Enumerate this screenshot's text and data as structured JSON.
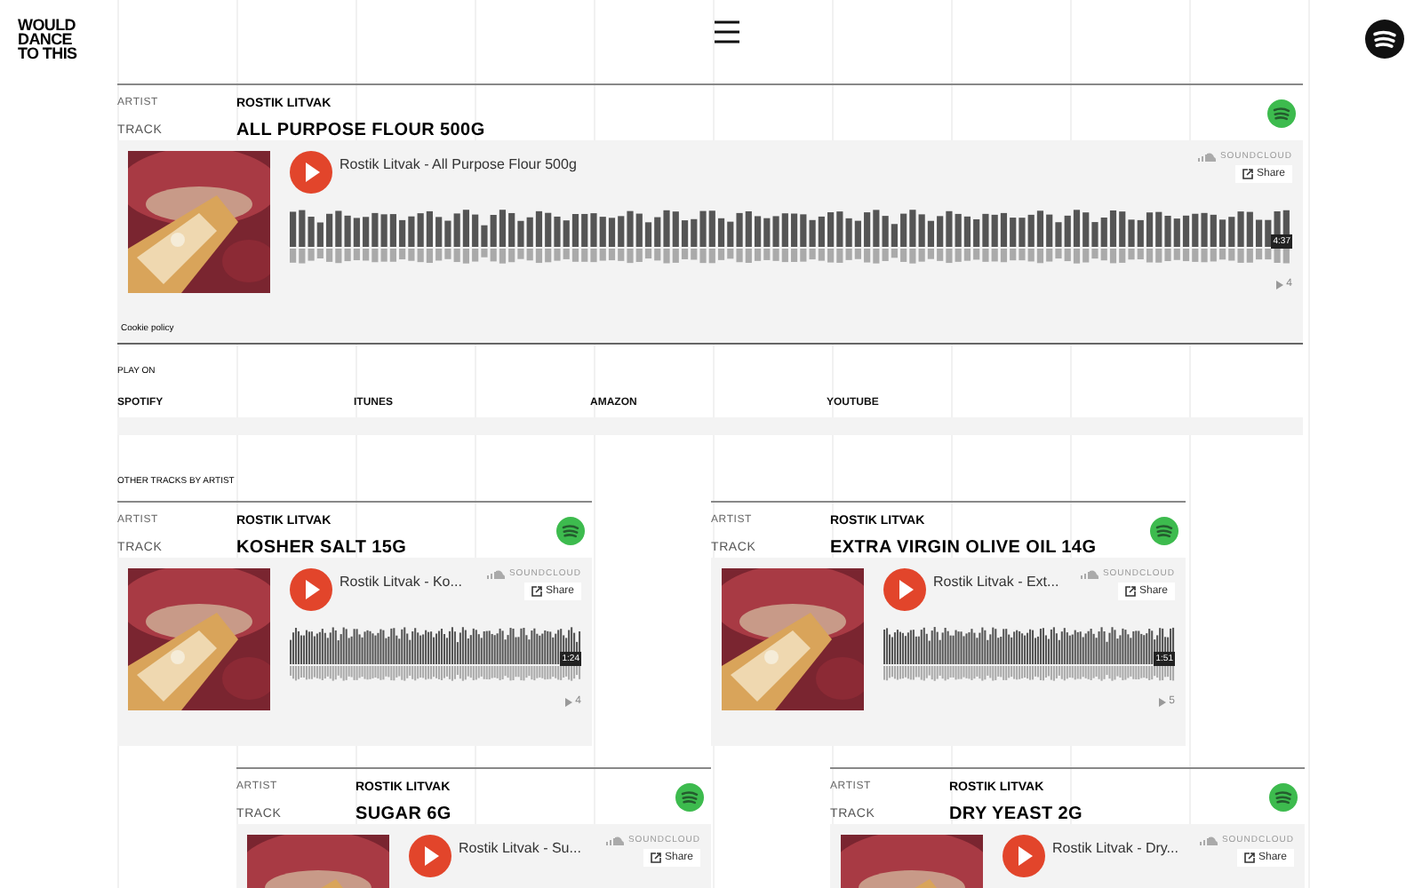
{
  "logo": "WOULD DANCE TO THIS",
  "featured": {
    "artist_label": "ARTIST",
    "artist": "ROSTIK LITVAK",
    "track_label": "TRACK",
    "track": "ALL PURPOSE FLOUR 500G",
    "player": {
      "title": "Rostik Litvak - All Purpose Flour 500g",
      "brand": "SOUNDCLOUD",
      "share": "Share",
      "duration": "4:37",
      "plays": "4"
    },
    "cookie": "Cookie policy"
  },
  "play_on": {
    "label": "PLAY ON",
    "links": [
      "SPOTIFY",
      "ITUNES",
      "AMAZON",
      "YOUTUBE"
    ]
  },
  "other_tracks": {
    "label": "OTHER TRACKS BY ARTIST",
    "tracks": [
      {
        "artist_label": "ARTIST",
        "artist": "ROSTIK LITVAK",
        "track_label": "TRACK",
        "track": "KOSHER SALT 15G",
        "player": {
          "title": "Rostik Litvak - Ko...",
          "brand": "SOUNDCLOUD",
          "share": "Share",
          "duration": "1:24",
          "plays": "4"
        }
      },
      {
        "artist_label": "ARTIST",
        "artist": "ROSTIK LITVAK",
        "track_label": "TRACK",
        "track": "EXTRA VIRGIN OLIVE OIL 14G",
        "player": {
          "title": "Rostik Litvak - Ext...",
          "brand": "SOUNDCLOUD",
          "share": "Share",
          "duration": "1:51",
          "plays": "5"
        }
      },
      {
        "artist_label": "ARTIST",
        "artist": "ROSTIK LITVAK",
        "track_label": "TRACK",
        "track": "SUGAR 6G",
        "player": {
          "title": "Rostik Litvak - Su...",
          "brand": "SOUNDCLOUD",
          "share": "Share"
        }
      },
      {
        "artist_label": "ARTIST",
        "artist": "ROSTIK LITVAK",
        "track_label": "TRACK",
        "track": "DRY YEAST 2G",
        "player": {
          "title": "Rostik Litvak - Dry...",
          "brand": "SOUNDCLOUD",
          "share": "Share"
        }
      }
    ]
  }
}
